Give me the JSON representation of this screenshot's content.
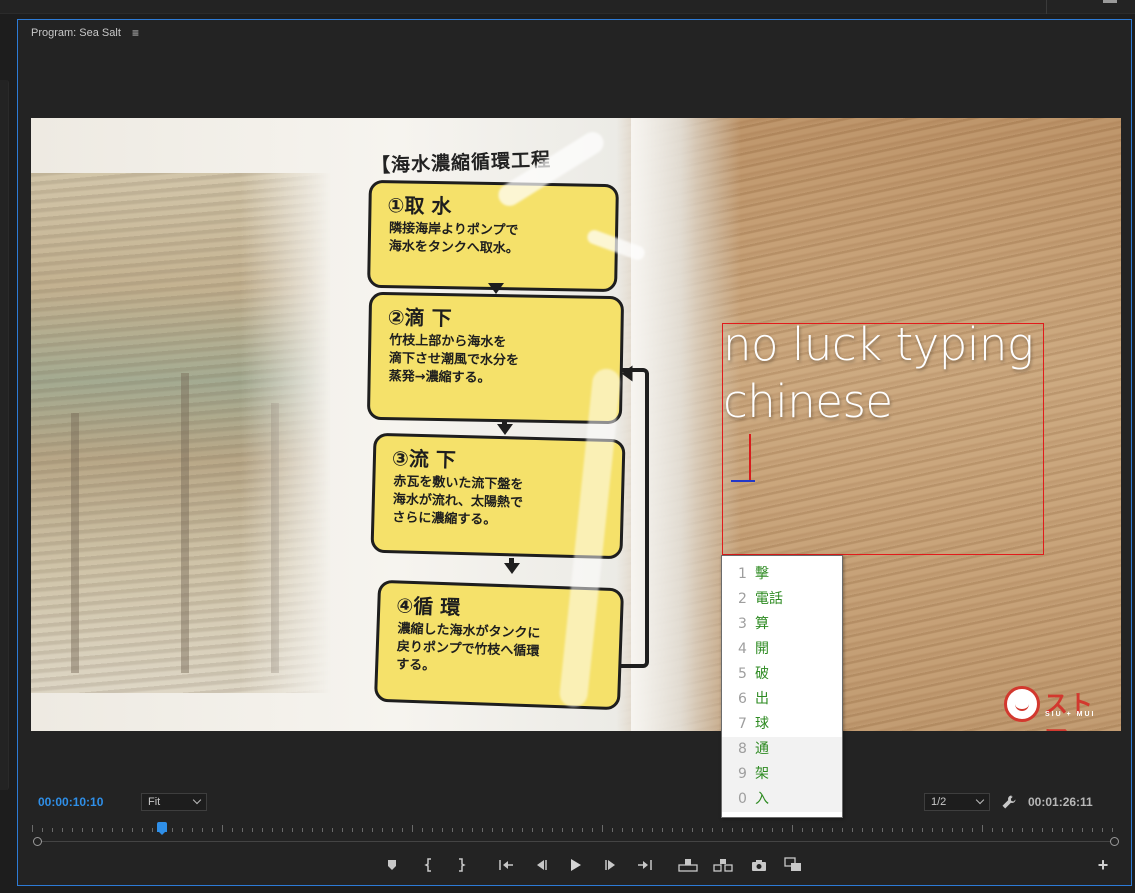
{
  "panel": {
    "title": "Program: Sea Salt",
    "menu_icon": "hamburger-icon"
  },
  "video": {
    "bag_title": "【海水濃縮循環工程",
    "steps": [
      {
        "head": "①取 水",
        "body": [
          "隣接海岸よりポンプで",
          "海水をタンクへ取水。"
        ]
      },
      {
        "head": "②滴 下",
        "body": [
          "竹枝上部から海水を",
          "滴下させ潮風で水分を",
          "蒸発→濃縮する。"
        ]
      },
      {
        "head": "③流 下",
        "body": [
          "赤瓦を敷いた流下盤を",
          "海水が流れ、太陽熱で",
          "さらに濃縮する。"
        ]
      },
      {
        "head": "④循 環",
        "body": [
          "濃縮した海水がタンクに",
          "戻りポンプで竹枝へ循環",
          "する。"
        ]
      }
    ],
    "overlay_line1": "no luck typing",
    "overlay_line2": "chinese",
    "logo_text": "ストア",
    "logo_sub": "SIU + MUI"
  },
  "ime": {
    "candidates": [
      {
        "num": "1",
        "text": "擊"
      },
      {
        "num": "2",
        "text": "電話"
      },
      {
        "num": "3",
        "text": "算"
      },
      {
        "num": "4",
        "text": "開"
      },
      {
        "num": "5",
        "text": "破"
      },
      {
        "num": "6",
        "text": "出"
      },
      {
        "num": "7",
        "text": "球"
      },
      {
        "num": "8",
        "text": "通"
      },
      {
        "num": "9",
        "text": "架"
      },
      {
        "num": "0",
        "text": "入"
      }
    ]
  },
  "controls": {
    "current_timecode": "00:00:10:10",
    "zoom_value": "Fit",
    "resolution_value": "1/2",
    "duration_timecode": "00:01:26:11",
    "transport_icons": [
      "add-marker-icon",
      "mark-in-icon",
      "mark-out-icon",
      "go-to-in-icon",
      "step-back-icon",
      "play-icon",
      "step-forward-icon",
      "go-to-out-icon",
      "lift-icon",
      "extract-icon",
      "export-frame-icon",
      "compare-view-icon"
    ]
  },
  "colors": {
    "accent": "#2f8fe8",
    "panel_border": "#2d7bd6",
    "text_box_border": "#e11b1b",
    "ime_candidate": "#2e8b22"
  }
}
